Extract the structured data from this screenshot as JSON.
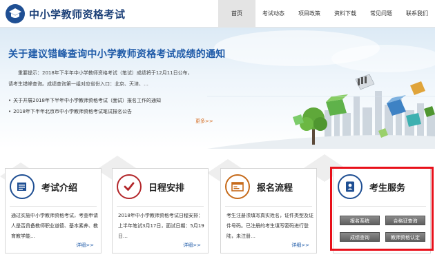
{
  "header": {
    "site_title": "中小学教师资格考试",
    "nav": [
      "首页",
      "考试动态",
      "项目政策",
      "资料下载",
      "常见问题",
      "联系我们"
    ]
  },
  "banner": {
    "headline": "关于建议错峰查询中小学教师资格考试成绩的通知",
    "tip_line1": "重要提示：2018年下半年中小学教师资格考试（笔试）成绩将于12月11日公布，",
    "tip_line2": "请考生错峰查询。成绩查询第一组对应省份入口：北京、天津、…",
    "links": [
      "关于开展2018年下半年中小学教师资格考试（面试）报名工作的通知",
      "2018年下半年北京市中小学教师资格考试笔试报名公告"
    ],
    "more": "更多>>"
  },
  "cards": [
    {
      "title": "考试介绍",
      "text": "通过实施中小学教师资格考试，考查申请人是否具备教师职业道德、基本素养、教育教学能…",
      "more": "详细>>",
      "icon": "document-icon",
      "color": "#1f4f93"
    },
    {
      "title": "日程安排",
      "text": "2018年中小学教师资格考试日程安排：上半年笔试3月17日，面试日期：5月19日…",
      "more": "详细>>",
      "icon": "checkmark-icon",
      "color": "#b3262a"
    },
    {
      "title": "报名流程",
      "text": "考生注册须填写真实姓名，证件类型及证件号码。已注册的考生填写密码进行登陆，未注册…",
      "more": "详细>>",
      "icon": "form-icon",
      "color": "#c66a1a"
    },
    {
      "title": "考生服务",
      "icon": "contact-card-icon",
      "color": "#1f4f93",
      "buttons": [
        "报名系统",
        "合格证查询",
        "成绩查询",
        "教师资格认定"
      ]
    }
  ],
  "colors": {
    "brand_blue": "#1f4f93",
    "headline_blue": "#1e5aa8",
    "highlight_red": "#e8101a",
    "more_orange": "#d46a1e"
  }
}
